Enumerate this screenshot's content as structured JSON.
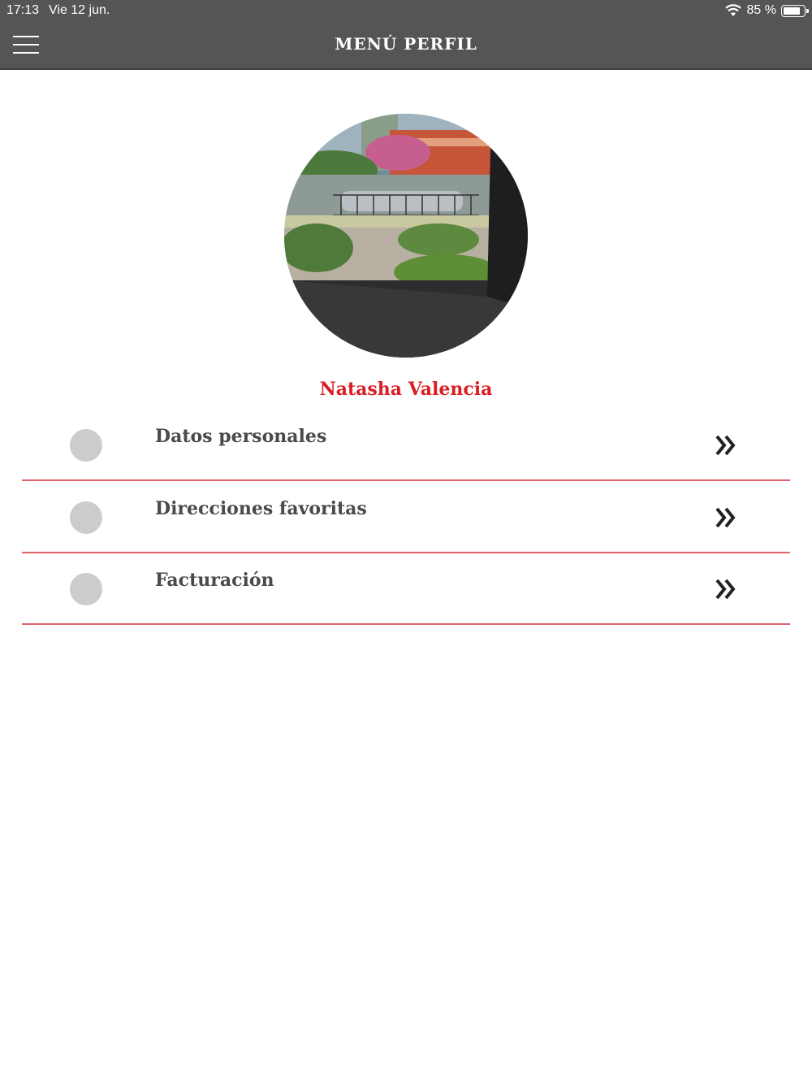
{
  "status_bar": {
    "time": "17:13",
    "date": "Vie 12 jun.",
    "battery": "85 %",
    "battery_level": 0.85
  },
  "header": {
    "title": "MENÚ PERFIL",
    "menu_icon": "hamburger-icon",
    "background": "#555555"
  },
  "profile": {
    "name": "Natasha Valencia",
    "name_color": "#d91f26",
    "photo_icon": "profile-photo"
  },
  "menu": {
    "items": [
      {
        "label": "Datos personales",
        "icon": "chevron-double-right-icon"
      },
      {
        "label": "Direcciones favoritas",
        "icon": "chevron-double-right-icon"
      },
      {
        "label": "Facturación",
        "icon": "chevron-double-right-icon"
      }
    ],
    "divider_color": "#e0626a"
  }
}
